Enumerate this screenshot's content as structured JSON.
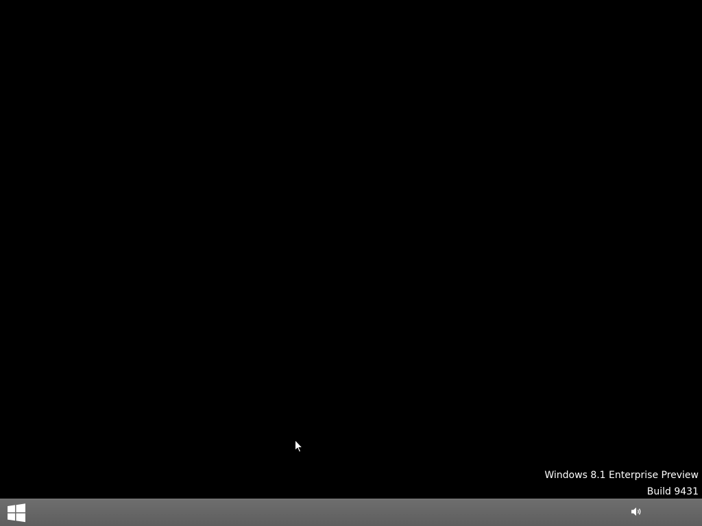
{
  "desktop": {
    "background_color": "#000000",
    "watermark": {
      "line1": "Windows 8.1 Enterprise Preview",
      "line2": "Build 9431"
    }
  },
  "cursor": {
    "icon": "arrow-cursor-icon"
  },
  "taskbar": {
    "color": "#666666",
    "start_button": {
      "icon": "windows-logo-icon"
    },
    "tray": {
      "volume": {
        "icon": "speaker-icon"
      }
    }
  }
}
